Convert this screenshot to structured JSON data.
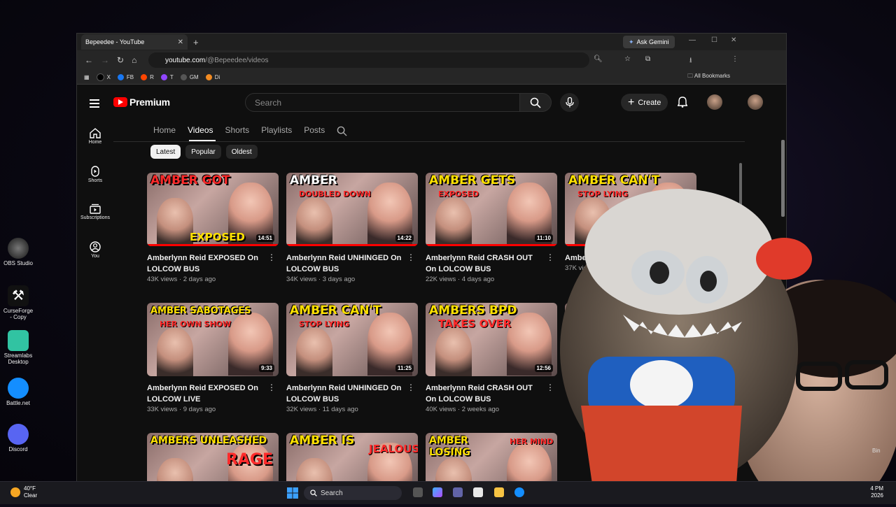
{
  "browser": {
    "tab_title": "Bepeedee - YouTube",
    "new_tab": "+",
    "ask_gemini": "Ask Gemini",
    "url_host": "youtube.com",
    "url_path": "/@Bepeedee/videos",
    "bookmarks": [
      "X",
      "FB",
      "R",
      "T",
      "GM",
      "Di"
    ],
    "all_bookmarks": "All Bookmarks"
  },
  "youtube": {
    "logo": "Premium",
    "search_placeholder": "Search",
    "create_label": "Create",
    "sidebar": [
      "Home",
      "Shorts",
      "Subscriptions",
      "You"
    ],
    "channel_tabs": [
      "Home",
      "Videos",
      "Shorts",
      "Playlists",
      "Posts"
    ],
    "active_tab": "Videos",
    "chips": [
      "Latest",
      "Popular",
      "Oldest"
    ],
    "videos": [
      {
        "thumb_text": "AMBER GOT",
        "thumb_sub": "",
        "thumb_bottom": "EXPOSED",
        "duration": "14:51",
        "title": "Amberlynn Reid EXPOSED On LOLCOW BUS",
        "meta": "43K views · 2 days ago"
      },
      {
        "thumb_text": "AMBER",
        "thumb_sub": "DOUBLED DOWN",
        "thumb_bottom": "",
        "duration": "14:22",
        "title": "Amberlynn Reid UNHINGED On LOLCOW BUS",
        "meta": "34K views · 3 days ago"
      },
      {
        "thumb_text": "AMBER GETS",
        "thumb_sub": "EXPOSED",
        "thumb_bottom": "",
        "duration": "11:10",
        "title": "Amberlynn Reid CRASH OUT On LOLCOW BUS",
        "meta": "22K views · 4 days ago"
      },
      {
        "thumb_text": "AMBER CAN'T",
        "thumb_sub": "STOP LYING",
        "thumb_bottom": "",
        "duration": "",
        "title": "Amberlyn",
        "meta": "37K views"
      },
      {
        "thumb_text": "AMBER SABOTAGES",
        "thumb_sub": "HER OWN SHOW",
        "thumb_bottom": "",
        "duration": "9:33",
        "title": "Amberlynn Reid EXPOSED On LOLCOW LIVE",
        "meta": "33K views · 9 days ago"
      },
      {
        "thumb_text": "AMBER CAN'T",
        "thumb_sub": "STOP LYING",
        "thumb_bottom": "",
        "duration": "11:25",
        "title": "Amberlynn Reid UNHINGED On LOLCOW BUS",
        "meta": "32K views · 11 days ago"
      },
      {
        "thumb_text": "AMBERS BPD",
        "thumb_sub": "TAKES OVER",
        "thumb_bottom": "",
        "duration": "12:56",
        "title": "Amberlynn Reid CRASH OUT On LOLCOW BUS",
        "meta": "40K views · 2 weeks ago"
      },
      {
        "thumb_text": "AMBE",
        "thumb_sub": "TE",
        "thumb_bottom": "",
        "duration": "",
        "title": "",
        "meta": ""
      },
      {
        "thumb_text": "AMBERS UNLEASHED",
        "thumb_sub": "",
        "thumb_bottom": "RAGE",
        "duration": "",
        "title": "",
        "meta": ""
      },
      {
        "thumb_text": "AMBER IS",
        "thumb_sub": "JEALOUS",
        "thumb_bottom": "",
        "duration": "",
        "title": "",
        "meta": ""
      },
      {
        "thumb_text": "AMBER",
        "thumb_sub": "LOSING",
        "thumb_bottom": "HER MIND",
        "duration": "",
        "title": "",
        "meta": ""
      }
    ]
  },
  "desktop": {
    "icons": [
      "OBS Studio",
      "CurseForge - Copy",
      "Streamlabs Desktop",
      "Battle.net",
      "Discord"
    ],
    "recycle_bin": "Bin"
  },
  "taskbar": {
    "temp": "40°F",
    "condition": "Clear",
    "search": "Search",
    "clock_time": "4 PM",
    "clock_date": "2026"
  },
  "colors": {
    "brand": "#ff0000",
    "accent_yellow": "#ffe100"
  }
}
